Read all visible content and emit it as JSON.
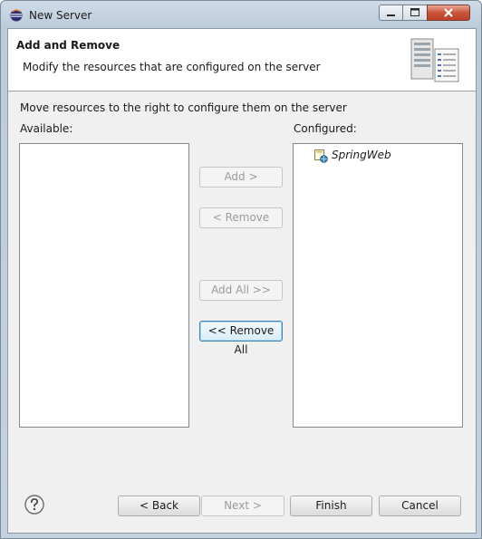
{
  "window": {
    "title": "New Server",
    "app_icon": "eclipse-icon",
    "controls": [
      "minimize-icon",
      "maximize-icon",
      "close-icon"
    ]
  },
  "banner": {
    "title": "Add and Remove",
    "description": "Modify the resources that are configured on the server",
    "image": "server-wizard-icon"
  },
  "instructions": "Move resources to the right to configure them on the server",
  "available": {
    "label": "Available:",
    "items": []
  },
  "configured": {
    "label": "Configured:",
    "items": [
      {
        "label": "SpringWeb",
        "icon": "web-project-icon"
      }
    ]
  },
  "transfer_buttons": {
    "add": "Add >",
    "remove": "< Remove",
    "add_all": "Add All >>",
    "remove_all": "<< Remove All"
  },
  "footer": {
    "help_icon": "help-icon",
    "back": "< Back",
    "next": "Next >",
    "finish": "Finish",
    "cancel": "Cancel"
  }
}
